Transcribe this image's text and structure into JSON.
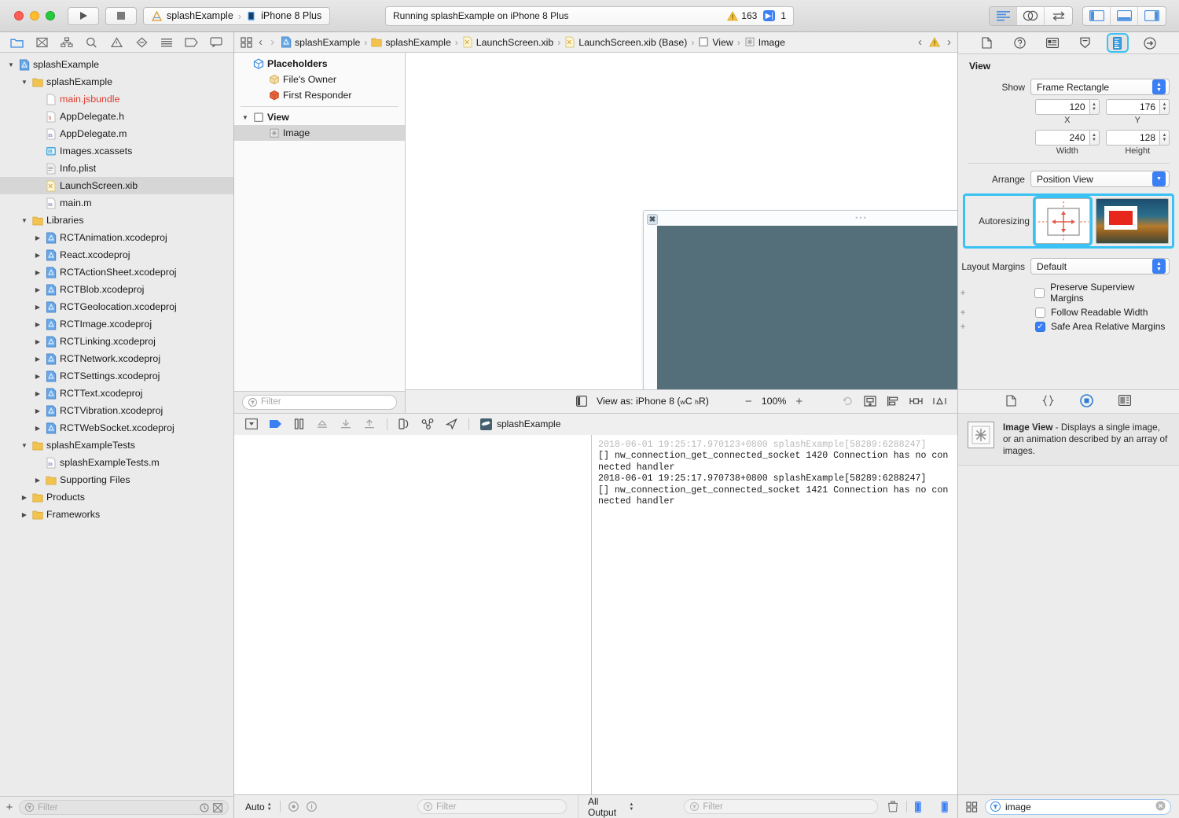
{
  "titlebar": {
    "run_label": "Run",
    "stop_label": "Stop",
    "scheme_project": "splashExample",
    "scheme_destination": "iPhone 8 Plus",
    "status_text": "Running splashExample on iPhone 8 Plus",
    "warning_count": "163",
    "issue_count": "1",
    "editor_modes": [
      "standard-editor",
      "assistant-editor",
      "version-editor"
    ],
    "panel_toggles": [
      "navigator-toggle",
      "debug-area-toggle",
      "utilities-toggle"
    ]
  },
  "navigator": {
    "tabs": [
      "project-navigator",
      "source-control-navigator",
      "symbol-navigator",
      "find-navigator",
      "issue-navigator",
      "test-navigator",
      "debug-navigator",
      "breakpoint-navigator",
      "report-navigator"
    ],
    "items": [
      {
        "label": "splashExample",
        "indent": 0,
        "twisty": "down",
        "icon": "project",
        "selected": false
      },
      {
        "label": "splashExample",
        "indent": 1,
        "twisty": "down",
        "icon": "folder",
        "selected": false
      },
      {
        "label": "main.jsbundle",
        "indent": 2,
        "twisty": "",
        "icon": "file-plain",
        "selected": false,
        "red": true
      },
      {
        "label": "AppDelegate.h",
        "indent": 2,
        "twisty": "",
        "icon": "file-h",
        "selected": false
      },
      {
        "label": "AppDelegate.m",
        "indent": 2,
        "twisty": "",
        "icon": "file-m",
        "selected": false
      },
      {
        "label": "Images.xcassets",
        "indent": 2,
        "twisty": "",
        "icon": "assets",
        "selected": false
      },
      {
        "label": "Info.plist",
        "indent": 2,
        "twisty": "",
        "icon": "plist",
        "selected": false
      },
      {
        "label": "LaunchScreen.xib",
        "indent": 2,
        "twisty": "",
        "icon": "xib",
        "selected": true
      },
      {
        "label": "main.m",
        "indent": 2,
        "twisty": "",
        "icon": "file-m",
        "selected": false
      },
      {
        "label": "Libraries",
        "indent": 1,
        "twisty": "down",
        "icon": "folder",
        "selected": false
      },
      {
        "label": "RCTAnimation.xcodeproj",
        "indent": 2,
        "twisty": "right",
        "icon": "project",
        "selected": false
      },
      {
        "label": "React.xcodeproj",
        "indent": 2,
        "twisty": "right",
        "icon": "project",
        "selected": false
      },
      {
        "label": "RCTActionSheet.xcodeproj",
        "indent": 2,
        "twisty": "right",
        "icon": "project",
        "selected": false
      },
      {
        "label": "RCTBlob.xcodeproj",
        "indent": 2,
        "twisty": "right",
        "icon": "project",
        "selected": false
      },
      {
        "label": "RCTGeolocation.xcodeproj",
        "indent": 2,
        "twisty": "right",
        "icon": "project",
        "selected": false
      },
      {
        "label": "RCTImage.xcodeproj",
        "indent": 2,
        "twisty": "right",
        "icon": "project",
        "selected": false
      },
      {
        "label": "RCTLinking.xcodeproj",
        "indent": 2,
        "twisty": "right",
        "icon": "project",
        "selected": false
      },
      {
        "label": "RCTNetwork.xcodeproj",
        "indent": 2,
        "twisty": "right",
        "icon": "project",
        "selected": false
      },
      {
        "label": "RCTSettings.xcodeproj",
        "indent": 2,
        "twisty": "right",
        "icon": "project",
        "selected": false
      },
      {
        "label": "RCTText.xcodeproj",
        "indent": 2,
        "twisty": "right",
        "icon": "project",
        "selected": false
      },
      {
        "label": "RCTVibration.xcodeproj",
        "indent": 2,
        "twisty": "right",
        "icon": "project",
        "selected": false
      },
      {
        "label": "RCTWebSocket.xcodeproj",
        "indent": 2,
        "twisty": "right",
        "icon": "project",
        "selected": false
      },
      {
        "label": "splashExampleTests",
        "indent": 1,
        "twisty": "down",
        "icon": "folder",
        "selected": false
      },
      {
        "label": "splashExampleTests.m",
        "indent": 2,
        "twisty": "",
        "icon": "file-m",
        "selected": false
      },
      {
        "label": "Supporting Files",
        "indent": 2,
        "twisty": "right",
        "icon": "folder",
        "selected": false
      },
      {
        "label": "Products",
        "indent": 1,
        "twisty": "right",
        "icon": "folder",
        "selected": false
      },
      {
        "label": "Frameworks",
        "indent": 1,
        "twisty": "right",
        "icon": "folder",
        "selected": false
      }
    ],
    "filter_placeholder": "Filter",
    "add_label": "+"
  },
  "jumpbar": {
    "back_label": "‹",
    "forward_label": "›",
    "crumbs": [
      {
        "label": "splashExample",
        "icon": "project"
      },
      {
        "label": "splashExample",
        "icon": "folder"
      },
      {
        "label": "LaunchScreen.xib",
        "icon": "xib"
      },
      {
        "label": "LaunchScreen.xib (Base)",
        "icon": "xib"
      },
      {
        "label": "View",
        "icon": "view"
      },
      {
        "label": "Image",
        "icon": "image"
      }
    ],
    "issue_prev": "‹",
    "issue_next": "›",
    "issue_icon": "warning-triangle"
  },
  "outline": {
    "items": [
      {
        "label": "Placeholders",
        "indent": 0,
        "twisty": "",
        "icon": "placeholders",
        "bold": true,
        "selected": false
      },
      {
        "label": "File's Owner",
        "indent": 1,
        "twisty": "",
        "icon": "files-owner",
        "selected": false
      },
      {
        "label": "First Responder",
        "indent": 1,
        "twisty": "",
        "icon": "first-responder",
        "selected": false
      },
      {
        "label": "View",
        "indent": 0,
        "twisty": "down",
        "icon": "view",
        "bold": true,
        "selected": false
      },
      {
        "label": "Image",
        "indent": 1,
        "twisty": "",
        "icon": "image",
        "selected": true
      }
    ],
    "filter_placeholder": "Filter"
  },
  "canvas": {
    "device_background": "#546e7a",
    "selected_element": "Image",
    "icon": "loop-arrows-icon",
    "view_as_label": "View as: iPhone 8",
    "view_as_traits_w": "C",
    "view_as_traits_h": "R",
    "view_as_w_prefix": "w",
    "view_as_h_prefix": "h",
    "zoom_out": "−",
    "zoom_level": "100%",
    "zoom_in": "+",
    "right_tools": [
      "update-frames-icon",
      "embed-in-icon",
      "align-icon",
      "pin-icon",
      "resolve-auto-layout-icon"
    ]
  },
  "debugbar": {
    "buttons": [
      "hide-debug-area-icon",
      "continue-icon",
      "pause-icon",
      "step-over-icon",
      "step-into-icon",
      "step-out-icon",
      "view-hierarchy-icon",
      "memory-graph-icon",
      "simulate-location-icon"
    ],
    "process_label": "splashExample",
    "process_icon": "loop-arrows-icon"
  },
  "console": {
    "lines": [
      {
        "text": "2018-06-01 19:25:17.970123+0800 splashExample[58289:6288247]",
        "faded": true
      },
      {
        "text": "[] nw_connection_get_connected_socket 1420 Connection has no connected handler",
        "faded": false
      },
      {
        "text": "2018-06-01 19:25:17.970738+0800 splashExample[58289:6288247]",
        "faded": false
      },
      {
        "text": "[] nw_connection_get_connected_socket 1421 Connection has no connected handler",
        "faded": false
      }
    ],
    "scope_label": "All Output",
    "filter_placeholder": "Filter",
    "clear_icon": "trash-icon",
    "variables_filter_placeholder": "Filter",
    "auto_label": "Auto"
  },
  "inspector": {
    "tabs": [
      "file-inspector",
      "quick-help-inspector",
      "identity-inspector",
      "attributes-inspector",
      "size-inspector",
      "connections-inspector"
    ],
    "active_tab": "size-inspector",
    "section_title": "View",
    "show_label": "Show",
    "show_value": "Frame Rectangle",
    "x_value": "120",
    "x_label": "X",
    "y_value": "176",
    "y_label": "Y",
    "width_value": "240",
    "width_label": "Width",
    "height_value": "128",
    "height_label": "Height",
    "arrange_label": "Arrange",
    "arrange_value": "Position View",
    "autoresizing_label": "Autoresizing",
    "layout_margins_label": "Layout Margins",
    "layout_margins_value": "Default",
    "checkboxes": [
      {
        "label": "Preserve Superview Margins",
        "checked": false
      },
      {
        "label": "Follow Readable Width",
        "checked": false
      },
      {
        "label": "Safe Area Relative Margins",
        "checked": true
      }
    ],
    "highlight_color": "#39c2f3",
    "accent_color": "#3b7ff5"
  },
  "library": {
    "tabs": [
      "file-template-library",
      "code-snippet-library",
      "object-library",
      "media-library"
    ],
    "active_tab": "object-library",
    "item_title": "Image View",
    "item_description": " - Displays a single image, or an animation described by an array of images.",
    "search_value": "image",
    "clear_icon": "clear-circle-icon",
    "grid_icon": "grid-icon"
  }
}
